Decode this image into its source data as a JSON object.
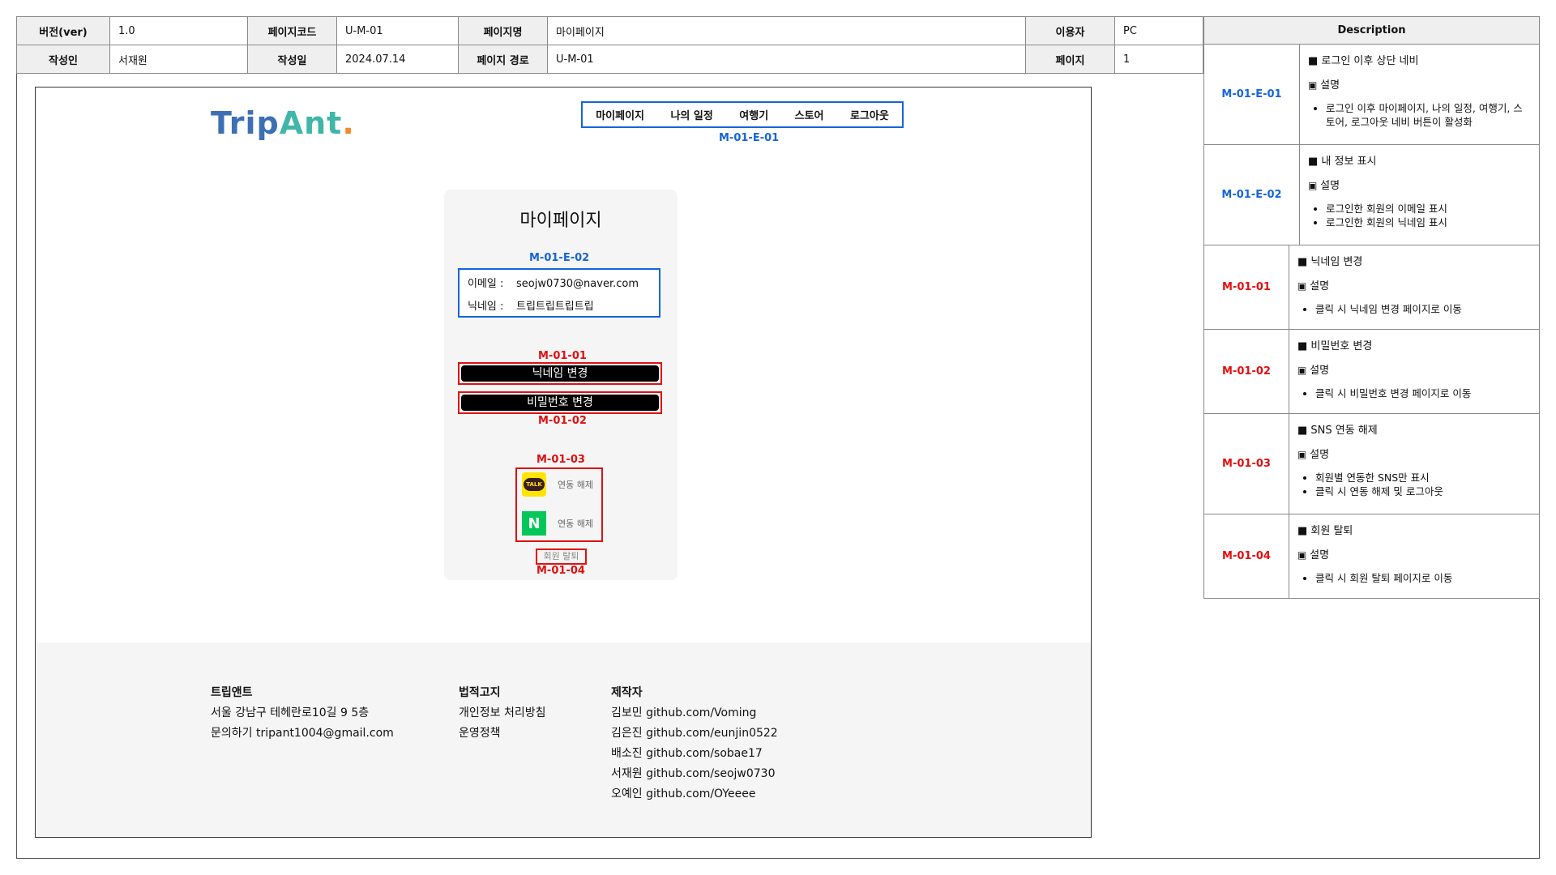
{
  "meta": {
    "version_label": "버전(ver)",
    "version": "1.0",
    "pagecode_label": "페이지코드",
    "pagecode": "U-M-01",
    "pagename_label": "페이지명",
    "pagename": "마이페이지",
    "user_label": "이용자",
    "user": "PC",
    "author_label": "작성인",
    "author": "서재원",
    "date_label": "작성일",
    "date": "2024.07.14",
    "path_label": "페이지 경로",
    "path": "U-M-01",
    "page_label": "페이지",
    "page": "1"
  },
  "description": {
    "header": "Description",
    "rows": [
      {
        "code": "M-01-E-01",
        "title": "로그인 이후 상단 네비",
        "sub": "설명",
        "bullets": [
          "로그인 이후 마이페이지, 나의 일정, 여행기, 스토어, 로그아웃 네비 버튼이 활성화"
        ]
      },
      {
        "code": "M-01-E-02",
        "title": "내 정보 표시",
        "sub": "설명",
        "bullets": [
          "로그인한 회원의 이메일 표시",
          "로그인한 회원의 닉네임 표시"
        ]
      },
      {
        "code": "M-01-01",
        "title": "닉네임 변경",
        "sub": "설명",
        "bullets": [
          "클릭 시 닉네임 변경 페이지로 이동"
        ]
      },
      {
        "code": "M-01-02",
        "title": "비밀번호 변경",
        "sub": "설명",
        "bullets": [
          "클릭 시 비밀번호 변경 페이지로 이동"
        ]
      },
      {
        "code": "M-01-03",
        "title": "SNS 연동 해제",
        "sub": "설명",
        "bullets": [
          "회원별 연동한 SNS만 표시",
          "클릭 시 연동 해제 및 로그아웃"
        ]
      },
      {
        "code": "M-01-04",
        "title": "회원 탈퇴",
        "sub": "설명",
        "bullets": [
          "클릭 시 회원 탈퇴 페이지로 이동"
        ]
      }
    ]
  },
  "logo": {
    "part1": "Trip",
    "part2": "Ant",
    "dot": "."
  },
  "nav": {
    "items": [
      "마이페이지",
      "나의 일정",
      "여행기",
      "스토어",
      "로그아웃"
    ],
    "code": "M-01-E-01"
  },
  "mypage": {
    "title": "마이페이지",
    "info_code": "M-01-E-02",
    "email_label": "이메일 :",
    "email": "seojw0730@naver.com",
    "nick_label": "닉네임 :",
    "nick": "트립트립트립트립",
    "nick_btn_code": "M-01-01",
    "nick_btn": "닉네임 변경",
    "pw_btn": "비밀번호 변경",
    "pw_btn_code": "M-01-02",
    "sns_code": "M-01-03",
    "kakao_icon": "TALK",
    "kakao_label": "연동 해제",
    "naver_icon": "N",
    "naver_label": "연동 해제",
    "withdraw": "회원 탈퇴",
    "withdraw_code": "M-01-04"
  },
  "footer": {
    "col1": {
      "title": "트립앤트",
      "lines": [
        "서울 강남구 테헤란로10길 9 5층",
        "문의하기 tripant1004@gmail.com"
      ]
    },
    "col2": {
      "title": "법적고지",
      "lines": [
        "개인정보 처리방침",
        "운영정책"
      ]
    },
    "col3": {
      "title": "제작자",
      "lines": [
        "김보민 github.com/Voming",
        "김은진 github.com/eunjin0522",
        "배소진 github.com/sobae17",
        "서재원 github.com/seojw0730",
        "오예인 github.com/OYeeee"
      ]
    }
  }
}
